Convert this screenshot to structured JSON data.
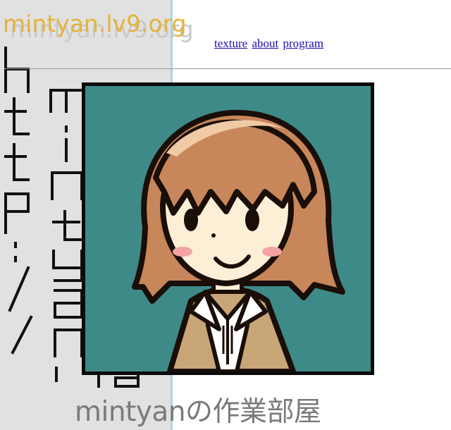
{
  "site": {
    "logo": "mintyan.lv9.org",
    "logo_shadow": "mintyan.lv9.org",
    "subtitle": "mintyanの作業部屋"
  },
  "nav": {
    "items": [
      {
        "label": "texture"
      },
      {
        "label": "about"
      },
      {
        "label": "program"
      }
    ]
  },
  "colors": {
    "logo": "#e4b33a",
    "logo_shadow": "#c9c9c9",
    "link": "#1a0dab",
    "left_band": "#e1e1e1",
    "band_edge": "#a9d6e6",
    "avatar_background": "#3e8a88",
    "hair": "#c8875a",
    "skin": "#fdefd6",
    "sweater": "#c9a677",
    "subtitle": "#7a7a7a"
  },
  "avatar": {
    "icon": "girl-avatar-illustration"
  }
}
